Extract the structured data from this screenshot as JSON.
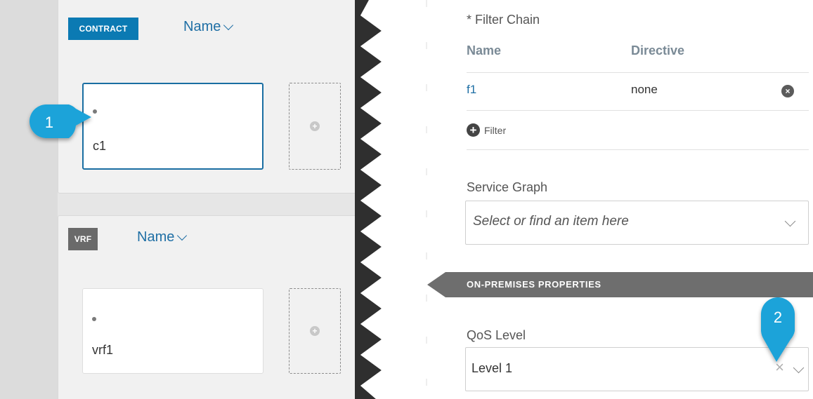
{
  "contract_card": {
    "tag": "CONTRACT",
    "sort_label": "Name",
    "item": {
      "label": "c1"
    }
  },
  "vrf_card": {
    "tag": "VRF",
    "sort_label": "Name",
    "item": {
      "label": "vrf1"
    }
  },
  "callouts": {
    "step1": "1",
    "step2": "2"
  },
  "filter_chain": {
    "title": "* Filter Chain",
    "columns": [
      "Name",
      "Directive"
    ],
    "rows": [
      {
        "name": "f1",
        "directive": "none"
      }
    ],
    "add_label": "Filter"
  },
  "service_graph": {
    "label": "Service Graph",
    "placeholder": "Select or find an item here"
  },
  "on_premises": {
    "section_title": "ON-PREMISES PROPERTIES"
  },
  "qos": {
    "label": "QoS Level",
    "value": "Level 1"
  },
  "colors": {
    "contract_tag": "#0b7ab3",
    "vrf_tag": "#6a6a6a",
    "accent_link": "#1f6fa5",
    "callout": "#1aa3d9",
    "section_band": "#6e6e6e"
  },
  "icons": {
    "sort_chevron": "chevron-down-icon",
    "add_slot": "plus-circle-icon",
    "remove_row": "close-circle-icon",
    "add_filter": "plus-circle-icon",
    "clear_selection": "close-icon",
    "dropdown": "chevron-down-icon"
  }
}
